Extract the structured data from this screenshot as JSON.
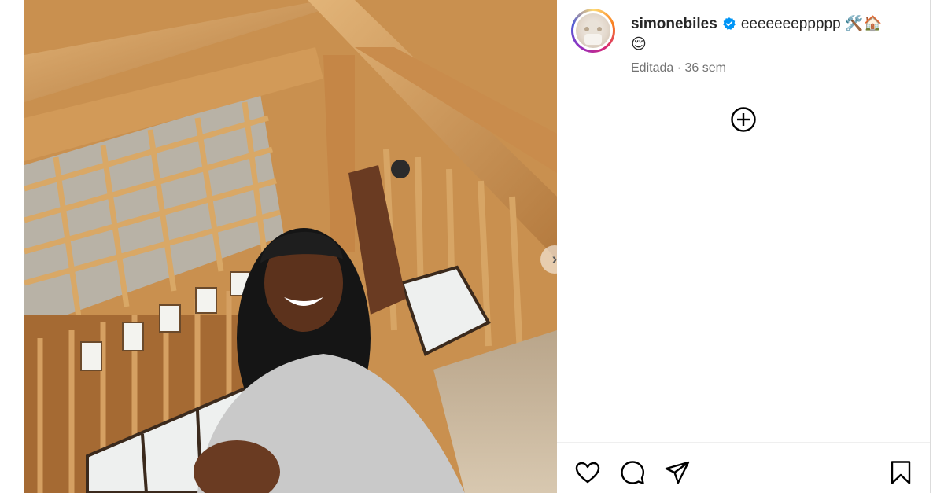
{
  "post": {
    "author": {
      "username": "simonebiles",
      "avatar_icon": "profile-photo",
      "verified_icon": "verified-badge-icon"
    },
    "caption_text": "eeeeeeeppppp",
    "caption_emojis": [
      "🛠️",
      "🏠",
      "😌"
    ],
    "edited_label": "Editada",
    "separator": "·",
    "age": "36 sem"
  },
  "actions": {
    "like_icon": "heart-icon",
    "comment_icon": "comment-icon",
    "share_icon": "send-icon",
    "save_icon": "bookmark-icon",
    "add_comment_icon": "plus-circle-icon"
  },
  "carousel": {
    "next_icon": "chevron-right-icon",
    "next_glyph": "›"
  },
  "colors": {
    "text": "#262626",
    "muted": "#737373",
    "verified": "#0095f6",
    "border": "#dbdbdb"
  }
}
